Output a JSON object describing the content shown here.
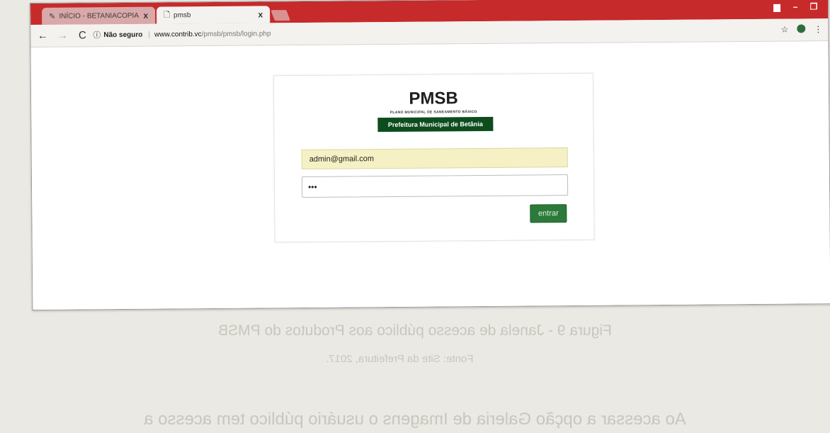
{
  "browser": {
    "tabs": [
      {
        "title": "INÍCIO - BETANIACOPIA",
        "close": "x"
      },
      {
        "title": "pmsb",
        "close": "x"
      }
    ],
    "address_bar": {
      "security_label": "Não seguro",
      "url_host": "www.contrib.vc",
      "url_path": "/pmsb/pmsb/login.php"
    }
  },
  "login": {
    "logo_title": "PMSB",
    "logo_subtitle": "PLANO MUNICIPAL DE SANEAMENTO BÁSICO",
    "logo_banner": "Prefeitura Municipal de Betânia",
    "email_value": "admin@gmail.com",
    "password_value": "•••",
    "submit_label": "entrar"
  },
  "document_caption": {
    "figure": "Figura 9 - Janela de acesso público aos Produtos do PMSB",
    "source": "Fonte: Site da Prefeitura, 2017.",
    "body": "Ao acessar a opção Galeria de Imagens o usuário público tem acesso a"
  },
  "colors": {
    "tabstrip": "#c62a2a",
    "banner": "#0d4d1d",
    "button": "#2b7a3a",
    "autofill": "#f5f1c4"
  },
  "icons": [
    "back-icon",
    "forward-icon",
    "reload-icon",
    "info-icon",
    "star-icon",
    "extension-icon",
    "menu-icon",
    "page-icon",
    "minimize-icon",
    "restore-icon"
  ]
}
